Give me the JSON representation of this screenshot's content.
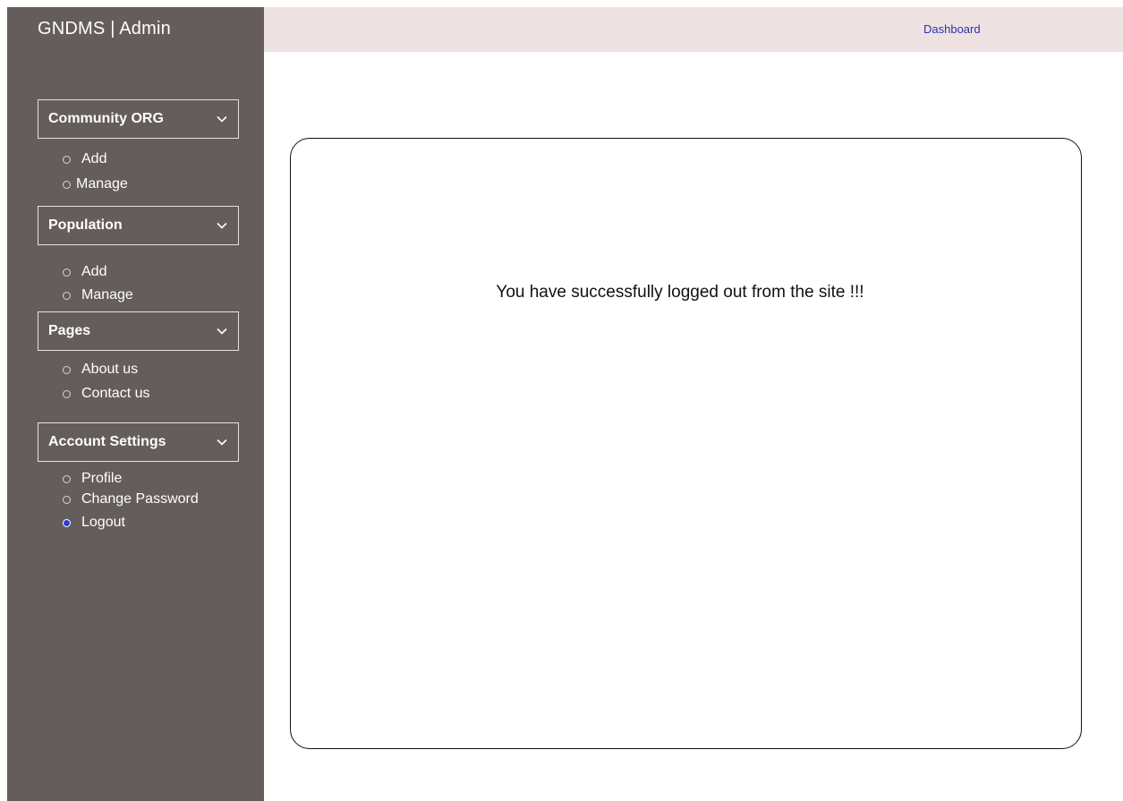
{
  "app": {
    "brand": "GNDMS | Admin"
  },
  "topbar": {
    "dashboard_link": "Dashboard"
  },
  "sidebar": {
    "sections": [
      {
        "title": "Community ORG",
        "items": [
          {
            "label": "Add"
          },
          {
            "label": "Manage"
          }
        ]
      },
      {
        "title": "Population",
        "items": [
          {
            "label": "Add"
          },
          {
            "label": "Manage"
          }
        ]
      },
      {
        "title": "Pages",
        "items": [
          {
            "label": "About us"
          },
          {
            "label": "Contact us"
          }
        ]
      },
      {
        "title": "Account Settings",
        "items": [
          {
            "label": "Profile"
          },
          {
            "label": "Change Password"
          },
          {
            "label": "Logout",
            "active": true
          }
        ]
      }
    ]
  },
  "main": {
    "message": "You have successfully logged out from the site !!!"
  },
  "colors": {
    "sidebar_bg": "#645d5b",
    "topbar_bg": "#eee2e2",
    "link": "#2b34a8",
    "active_radio": "#2f3bd8"
  },
  "icons": {
    "section_toggle": "chevron-down-icon",
    "item_marker": "radio-circle-icon"
  }
}
